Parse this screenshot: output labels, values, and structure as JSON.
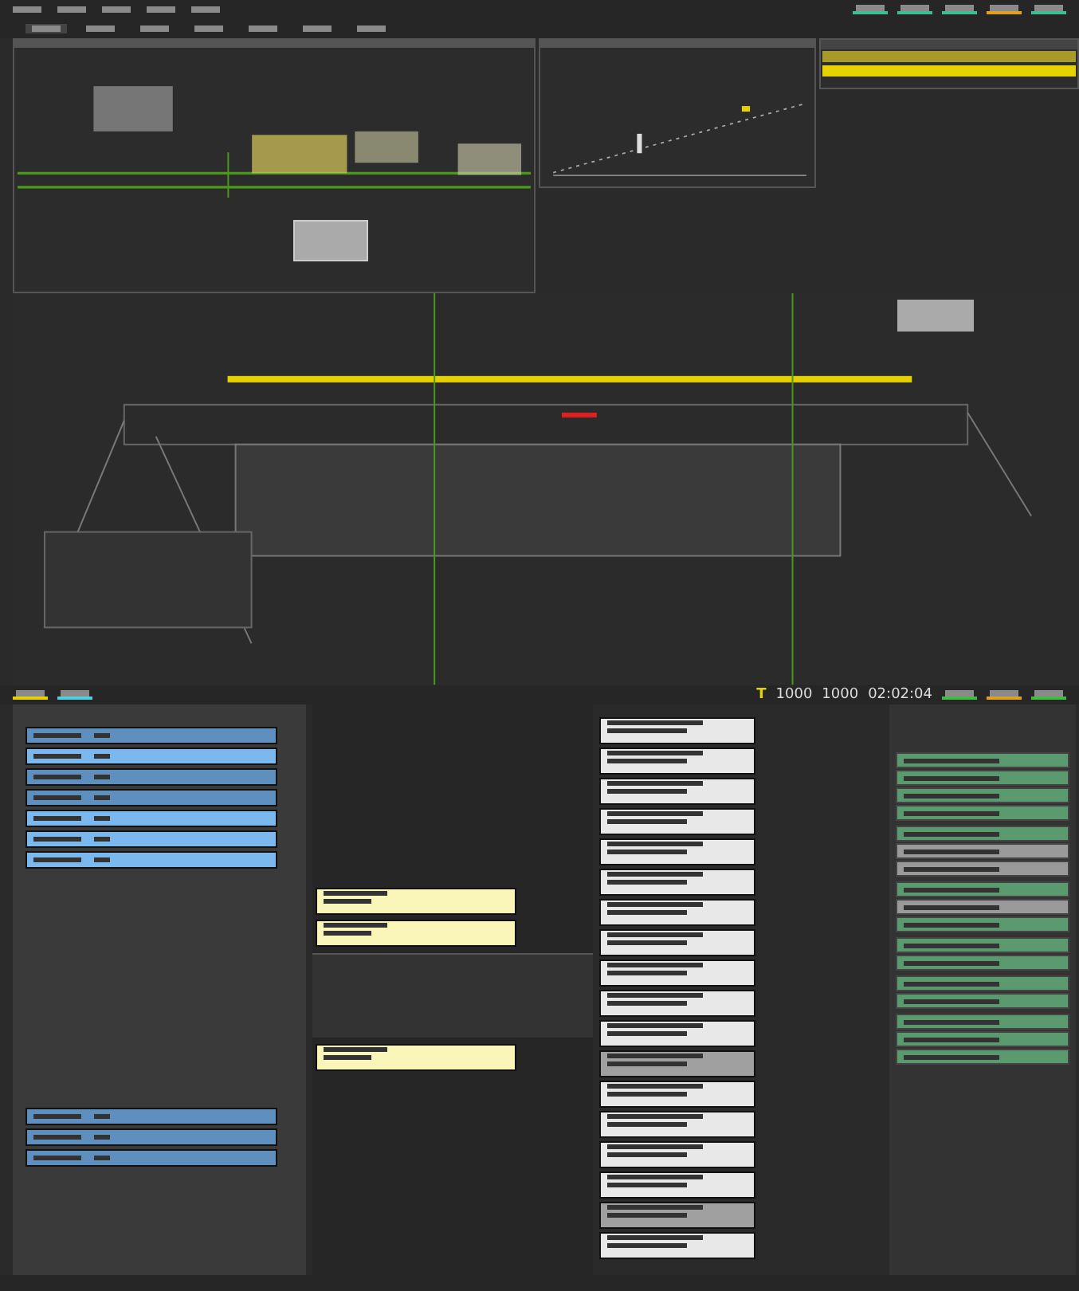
{
  "top_bar": {
    "indicators": [
      {
        "color": "#3fbf8f"
      },
      {
        "color": "#3fbf8f"
      },
      {
        "color": "#3fbf8f"
      },
      {
        "color": "#e0a020"
      },
      {
        "color": "#3fbf8f"
      }
    ]
  },
  "toolbar": {
    "tabs": [
      {
        "selected": true
      },
      {
        "selected": false
      },
      {
        "selected": false
      },
      {
        "selected": false
      },
      {
        "selected": false
      },
      {
        "selected": false
      },
      {
        "selected": false
      }
    ]
  },
  "upper_table": {
    "rows": [
      {
        "selected": false
      },
      {
        "selected": true
      }
    ]
  },
  "status_bar": {
    "left_indicators": [
      {
        "color": "#e6d200"
      },
      {
        "color": "#4fd0e0"
      }
    ],
    "mode": "T",
    "readings": [
      "1000",
      "1000"
    ],
    "time": "02:02:04",
    "right_indicators": [
      {
        "color": "#3fbf3f"
      },
      {
        "color": "#e0a020"
      },
      {
        "color": "#3fbf3f"
      }
    ]
  },
  "arrival_list": {
    "rows": [
      {
        "selected": false
      },
      {
        "selected": true
      },
      {
        "selected": false
      },
      {
        "selected": false
      },
      {
        "selected": true
      },
      {
        "selected": true
      },
      {
        "selected": true
      }
    ]
  },
  "departure_list": {
    "rows": [
      {
        "selected": false
      },
      {
        "selected": false
      },
      {
        "selected": false
      }
    ]
  },
  "pending_strips": [
    {
      "selected": false
    },
    {
      "selected": false
    }
  ],
  "active_strips": [
    {
      "selected": false
    }
  ],
  "strip_bay": [
    {
      "selected": false
    },
    {
      "selected": false
    },
    {
      "selected": false
    },
    {
      "selected": false
    },
    {
      "selected": false
    },
    {
      "selected": false
    },
    {
      "selected": false
    },
    {
      "selected": false
    },
    {
      "selected": false
    },
    {
      "selected": false
    },
    {
      "selected": false
    },
    {
      "selected": true
    },
    {
      "selected": false
    },
    {
      "selected": false
    },
    {
      "selected": false
    },
    {
      "selected": false
    },
    {
      "selected": true
    },
    {
      "selected": false
    }
  ],
  "messages": [
    [
      {
        "kind": "normal"
      },
      {
        "kind": "normal"
      },
      {
        "kind": "normal"
      },
      {
        "kind": "normal"
      }
    ],
    [
      {
        "kind": "normal"
      },
      {
        "kind": "dim"
      },
      {
        "kind": "dim"
      }
    ],
    [
      {
        "kind": "normal"
      },
      {
        "kind": "dim"
      },
      {
        "kind": "normal"
      }
    ],
    [
      {
        "kind": "normal"
      },
      {
        "kind": "normal"
      }
    ],
    [
      {
        "kind": "normal"
      },
      {
        "kind": "normal"
      }
    ],
    [
      {
        "kind": "normal"
      },
      {
        "kind": "normal"
      },
      {
        "kind": "normal"
      }
    ]
  ]
}
